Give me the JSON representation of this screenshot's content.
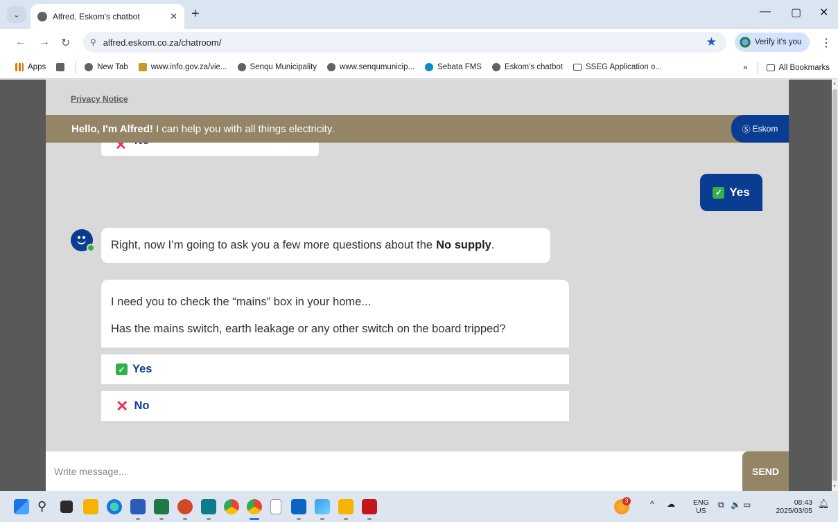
{
  "browser": {
    "tab_title": "Alfred, Eskom's chatbot",
    "url": "alfred.eskom.co.za/chatroom/",
    "verify_label": "Verify it's you",
    "bookmarks": [
      {
        "label": "Apps",
        "icon": "apps-icon"
      },
      {
        "label": "New Tab",
        "icon": "globe-icon"
      },
      {
        "label": "www.info.gov.za/vie...",
        "icon": "gov-icon"
      },
      {
        "label": "Senqu Municipality",
        "icon": "globe-icon"
      },
      {
        "label": "www.senqumunicip...",
        "icon": "globe-icon"
      },
      {
        "label": "Sebata FMS",
        "icon": "sebata-icon"
      },
      {
        "label": "Eskom's chatbot",
        "icon": "globe-icon"
      },
      {
        "label": "SSEG Application o...",
        "icon": "folder-icon"
      }
    ],
    "overflow": "»",
    "all_bookmarks": "All Bookmarks"
  },
  "chat": {
    "privacy_notice": "Privacy Notice",
    "banner_greeting": "Hello, I'm Alfred!",
    "banner_text": "I can help you with all things electricity.",
    "brand": "Eskom",
    "previous_option_no": "No",
    "user_reply": "Yes",
    "bot_message_prefix": "Right, now I’m going to ask you a few more questions about the",
    "bot_message_bold": "No supply",
    "bot_message_suffix": ".",
    "question_line1": "I need you to check the “mains” box in your home...",
    "question_line2": "Has the mains switch, earth leakage or any other switch on the board tripped?",
    "option_yes": "Yes",
    "option_no": "No",
    "input_placeholder": "Write message...",
    "send_label": "SEND"
  },
  "taskbar": {
    "notification_badge": "3",
    "lang_line1": "ENG",
    "lang_line2": "US",
    "time": "08:43",
    "date": "2025/03/05"
  },
  "colors": {
    "eskom_blue": "#0a3d91",
    "banner_tan": "#938566",
    "check_green": "#32b04a",
    "no_red": "#e8304f"
  }
}
